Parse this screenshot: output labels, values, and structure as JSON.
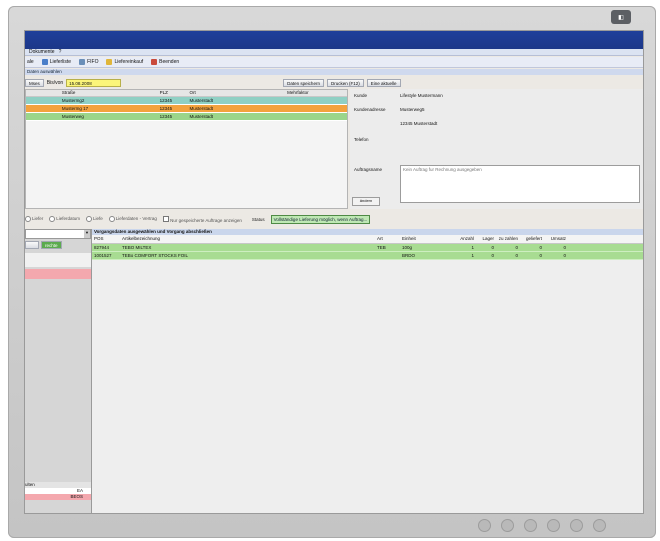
{
  "menu": {
    "items": [
      "Dokumente",
      "?"
    ]
  },
  "toolbar": {
    "items": [
      {
        "label": "ale",
        "icon": "window-icon"
      },
      {
        "label": "Lieferliste",
        "icon": "list-icon"
      },
      {
        "label": "FIFO",
        "icon": "sort-icon"
      },
      {
        "label": "Liefereinkauf",
        "icon": "folder-icon"
      },
      {
        "label": "Beenden",
        "icon": "exit-icon"
      }
    ]
  },
  "section": {
    "title": "Daten auswählen"
  },
  "filter": {
    "left_btn": "Mses",
    "label": "Bis/von",
    "date_value": "15.08.2008",
    "buttons": [
      "Daten speichern",
      "Drucken (F12)",
      "Eine aktuelle"
    ]
  },
  "top_grid": {
    "headers": [
      "",
      "Straße",
      "PLZ",
      "Ort",
      "Mehrfaktor"
    ],
    "rows": [
      {
        "c0": "",
        "c1": "Mustermg2",
        "c2": "12345",
        "c3": "Musterstadt",
        "c4": "",
        "color": "#8fd0c4"
      },
      {
        "c0": "",
        "c1": "Mustermg 17",
        "c2": "12345",
        "c3": "Musterstadt",
        "c4": "",
        "color": "#f3a23d"
      },
      {
        "c0": "",
        "c1": "Musterweg",
        "c2": "12345",
        "c3": "Musterstadt",
        "c4": "",
        "color": "#9bd58a"
      }
    ]
  },
  "details": {
    "rows": [
      {
        "label": "Kunde",
        "value": "Lifestyle Mustermann"
      },
      {
        "label": "Kundenadresse",
        "value": "Musterweg5"
      },
      {
        "label": "",
        "value": "12345 Musterstadt"
      },
      {
        "label": "Telefon",
        "value": ""
      },
      {
        "label": "Auftragsname",
        "value": ""
      }
    ],
    "textbox": "Kein Auftrag fur Rechnung ausgegeben",
    "small_button": "ändern"
  },
  "options": {
    "radios": [
      "Liefer",
      "Lieferdatum",
      "Liefe",
      "Lieferdaten - Vertrag"
    ],
    "checkbox": "Nur gespeicherte Auftrage anzeigen",
    "status_label": "Status",
    "status_value": "Vollständige Lieferung möglich, wenn Auftrag..."
  },
  "sidebar": {
    "button": "rechte",
    "bottom_label": "ulten",
    "bottom_values": [
      "EA",
      "BEOS"
    ]
  },
  "main": {
    "title": "Vorgangsdaten ausgewählen und Vorgang abschließen",
    "headers": [
      "POS",
      "Artikelbezeichnung",
      "Art",
      "Einheit",
      "Anzahl",
      "Lager",
      "zu zahlen",
      "geliefert",
      "Umsatz"
    ],
    "rows": [
      {
        "pos": "827944",
        "name": "TEBO MILTEX",
        "art": "TEB",
        "unit": "100g",
        "qty": "1",
        "lager": "0",
        "pay": "0",
        "deliv": "0",
        "sales": "0"
      },
      {
        "pos": "1001527",
        "name": "TEBo COMFORT STOCKS FOIL",
        "art": "",
        "unit": "BRDO",
        "qty": "1",
        "lager": "0",
        "pay": "0",
        "deliv": "0",
        "sales": "0"
      }
    ]
  }
}
